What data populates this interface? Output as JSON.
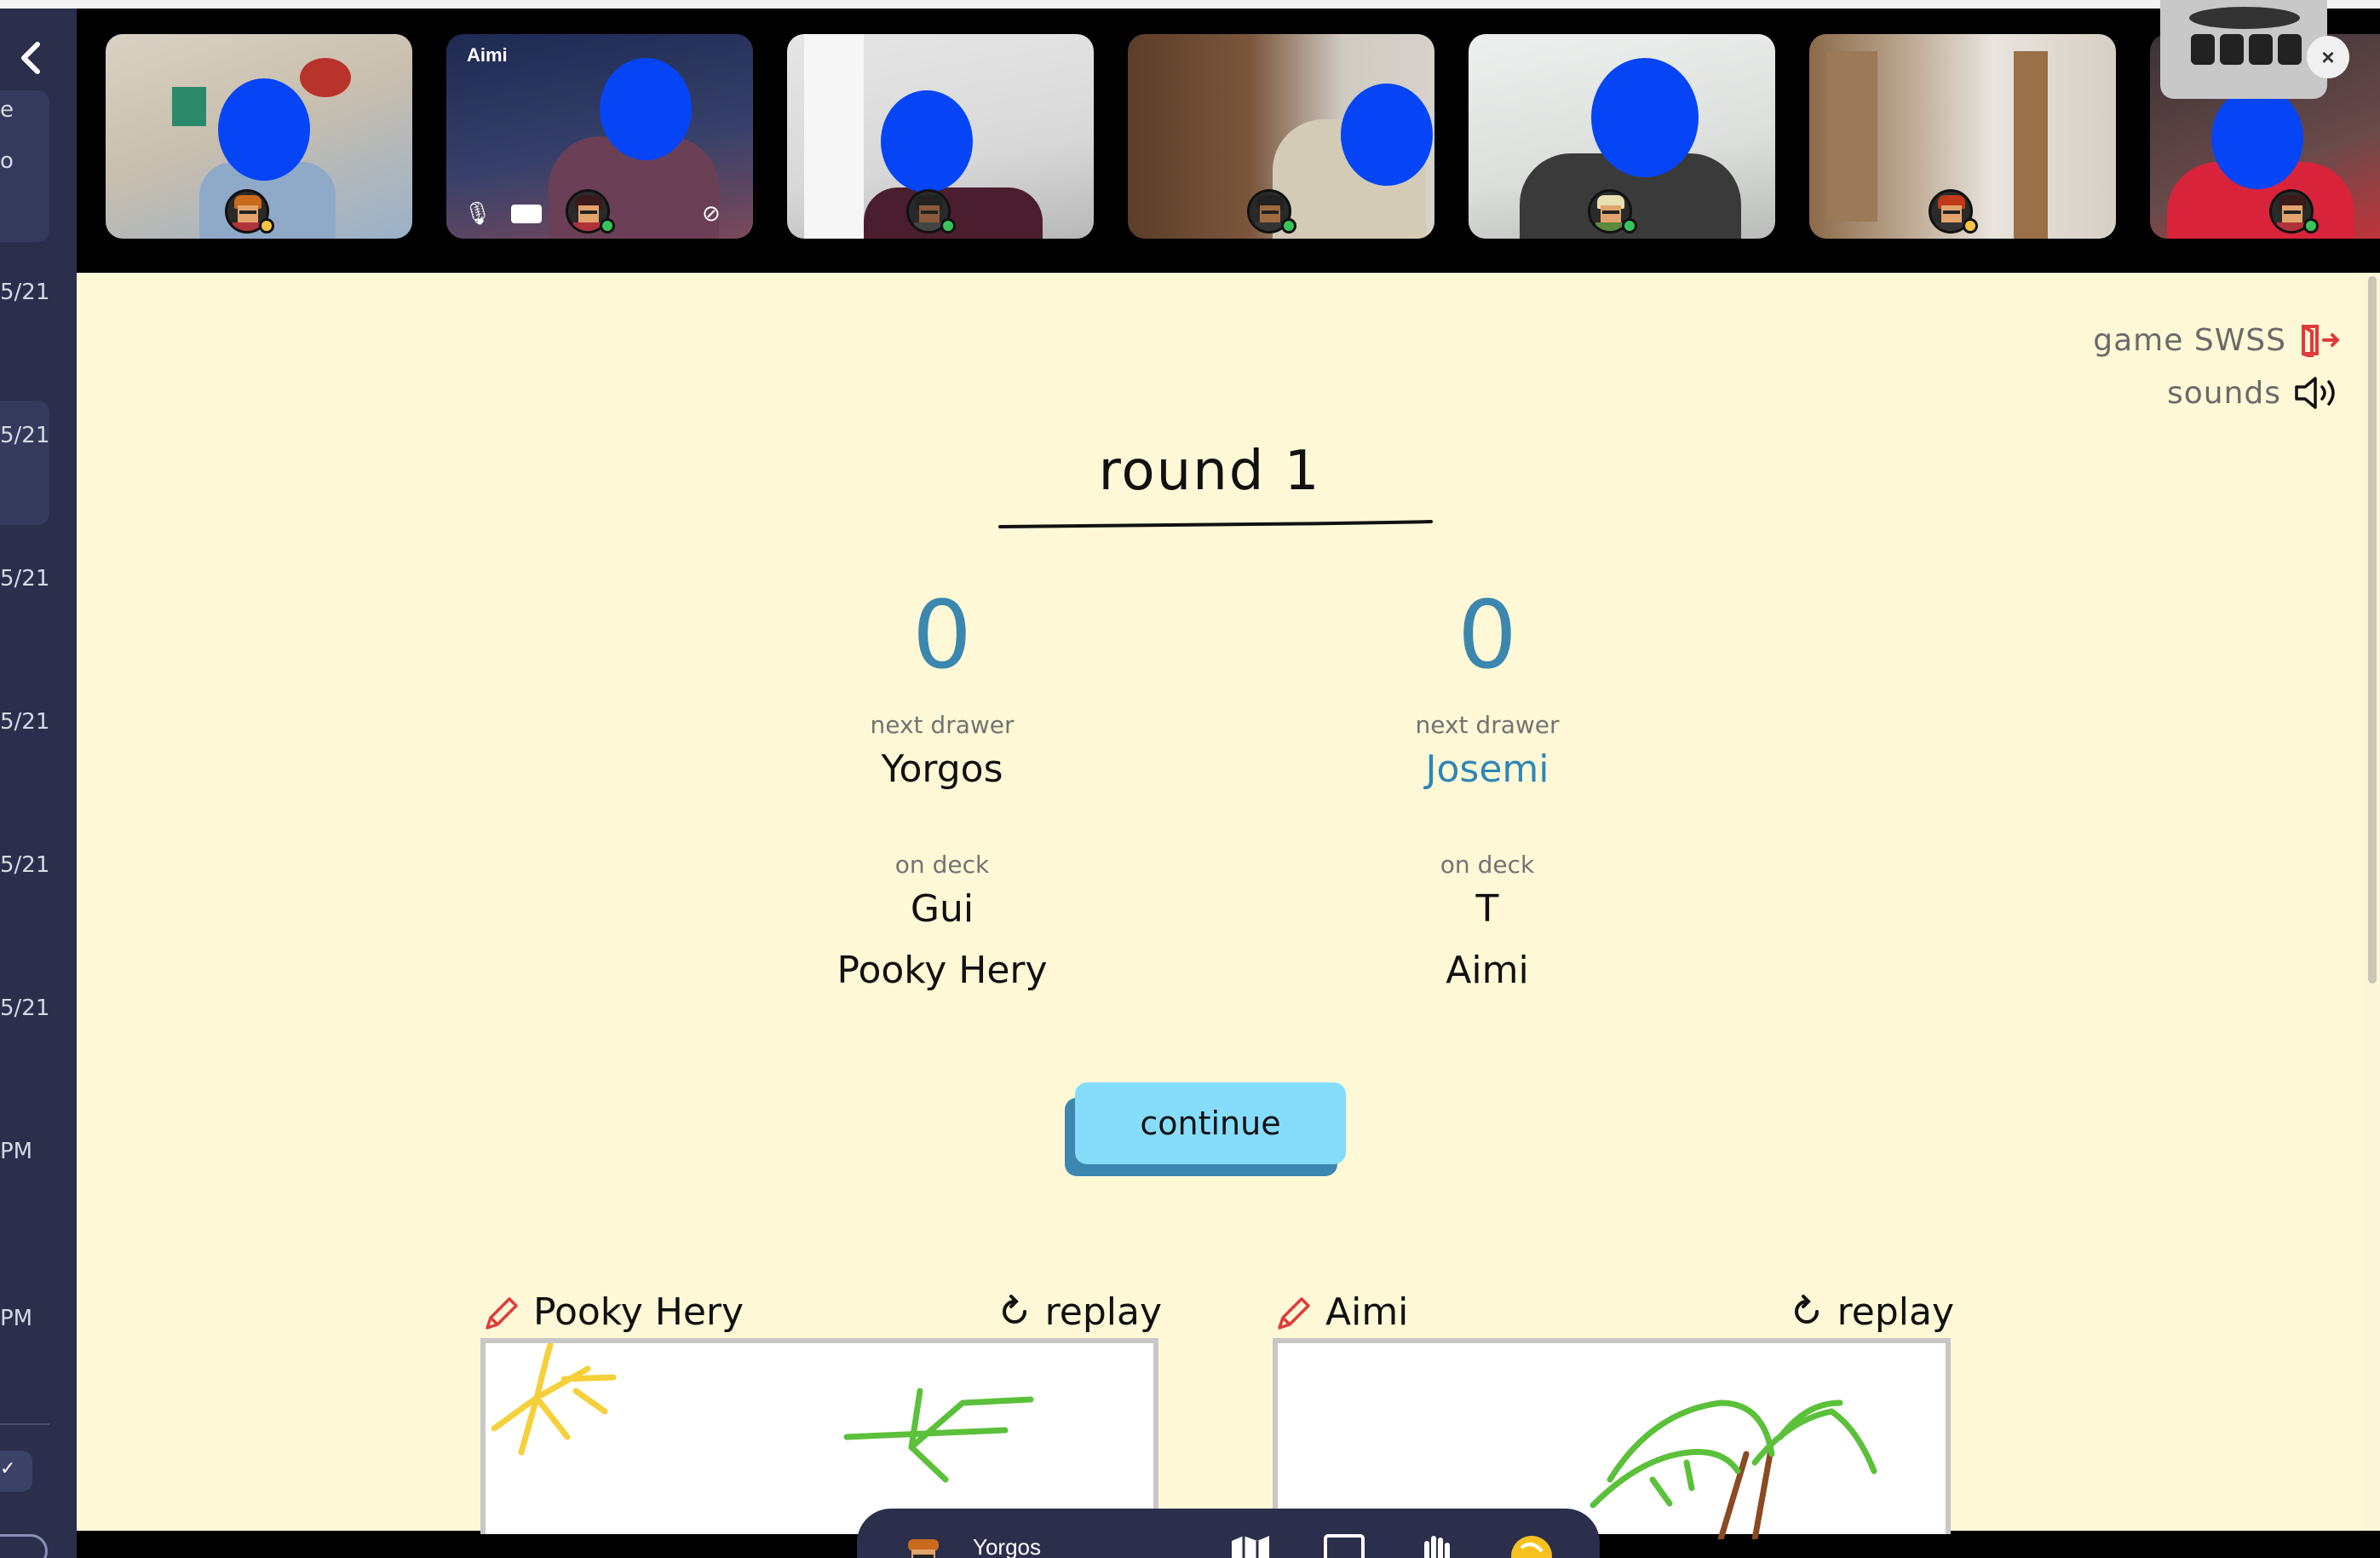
{
  "sidebar": {
    "edge_texts": [
      "e",
      "o",
      "5/21",
      "5/21",
      "5/21",
      "5/21",
      "5/21",
      "5/21",
      "PM",
      "PM"
    ]
  },
  "video_tiles": [
    {
      "name": "",
      "status": "#f5c542"
    },
    {
      "name": "Aimi",
      "status": "#37c45a"
    },
    {
      "name": "",
      "status": "#37c45a"
    },
    {
      "name": "",
      "status": "#37c45a"
    },
    {
      "name": "",
      "status": "#37c45a"
    },
    {
      "name": "",
      "status": "#f5c542"
    },
    {
      "name": "",
      "status": "#37c45a"
    }
  ],
  "game": {
    "game_label": "game SWSS",
    "sounds_label": "sounds",
    "round_title": "round 1",
    "teams": [
      {
        "score": "0",
        "next_drawer_label": "next drawer",
        "next_drawer": "Yorgos",
        "on_deck_label": "on deck",
        "on_deck": [
          "Gui",
          "Pooky Hery"
        ]
      },
      {
        "score": "0",
        "next_drawer_label": "next drawer",
        "next_drawer": "Josemi",
        "on_deck_label": "on deck",
        "on_deck": [
          "T",
          "Aimi"
        ]
      }
    ],
    "continue_label": "continue",
    "drawings": [
      {
        "artist": "Pooky Hery",
        "replay_label": "replay"
      },
      {
        "artist": "Aimi",
        "replay_label": "replay"
      }
    ]
  },
  "bottom_bar": {
    "user_name": "Yorgos"
  },
  "colors": {
    "accent_blue": "#3b87b0",
    "button_blue": "#86dcfb",
    "game_bg": "#fef8d6",
    "exit_red": "#e03b3b"
  }
}
